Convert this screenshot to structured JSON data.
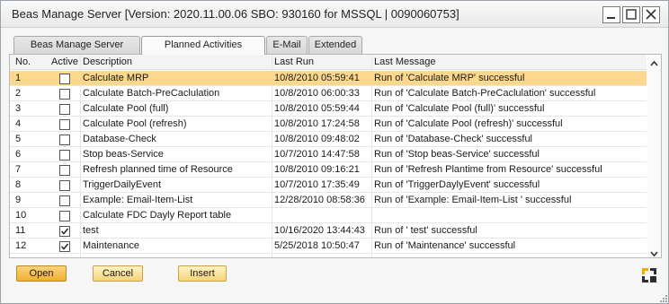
{
  "window": {
    "title": "Beas Manage Server [Version: 2020.11.00.06 SBO: 930160 for MSSQL | 0090060753]"
  },
  "tabs": [
    {
      "label": "Beas Manage Server",
      "active": false
    },
    {
      "label": "Planned Activities",
      "active": true
    },
    {
      "label": "E-Mail",
      "active": false
    },
    {
      "label": "Extended",
      "active": false
    }
  ],
  "grid": {
    "headers": {
      "no": "No.",
      "active": "Active",
      "description": "Description",
      "last_run": "Last Run",
      "last_message": "Last Message"
    },
    "rows": [
      {
        "no": "1",
        "active": false,
        "description": "Calculate MRP",
        "last_run": "10/8/2010 05:59:41",
        "last_message": "Run of 'Calculate MRP' successful",
        "selected": true
      },
      {
        "no": "2",
        "active": false,
        "description": "Calculate Batch-PreCaclulation",
        "last_run": "10/8/2010 06:00:33",
        "last_message": "Run of 'Calculate Batch-PreCaclulation' successful"
      },
      {
        "no": "3",
        "active": false,
        "description": "Calculate Pool (full)",
        "last_run": "10/8/2010 05:59:44",
        "last_message": "Run of 'Calculate Pool (full)' successful"
      },
      {
        "no": "4",
        "active": false,
        "description": "Calculate Pool (refresh)",
        "last_run": "10/8/2010 17:24:58",
        "last_message": "Run of 'Calculate Pool (refresh)' successful"
      },
      {
        "no": "5",
        "active": false,
        "description": "Database-Check",
        "last_run": "10/8/2010 09:48:02",
        "last_message": "Run of 'Database-Check' successful"
      },
      {
        "no": "6",
        "active": false,
        "description": "Stop beas-Service",
        "last_run": "10/7/2010 14:47:58",
        "last_message": "Run of 'Stop beas-Service' successful"
      },
      {
        "no": "7",
        "active": false,
        "description": "Refresh planned time of Resource",
        "last_run": "10/8/2010 09:16:21",
        "last_message": "Run of 'Refresh Plantime from Resource' successful"
      },
      {
        "no": "8",
        "active": false,
        "description": "TriggerDailyEvent",
        "last_run": "10/7/2010 17:35:49",
        "last_message": "Run of 'TriggerDaylyEvent' successful"
      },
      {
        "no": "9",
        "active": false,
        "description": "Example: Email-Item-List",
        "last_run": "12/28/2010 08:58:36",
        "last_message": "Run of 'Example: Email-Item-List ' successful"
      },
      {
        "no": "10",
        "active": false,
        "description": "Calculate FDC Dayly Report table",
        "last_run": "",
        "last_message": ""
      },
      {
        "no": "11",
        "active": true,
        "description": "test",
        "last_run": "10/16/2020 13:44:43",
        "last_message": "Run of ' test' successful"
      },
      {
        "no": "12",
        "active": true,
        "description": "Maintenance",
        "last_run": "5/25/2018 10:50:47",
        "last_message": "Run of 'Maintenance' successful"
      }
    ]
  },
  "buttons": {
    "open": "Open",
    "cancel": "Cancel",
    "insert": "Insert"
  },
  "icons": {
    "minimize": "minimize-icon",
    "maximize": "maximize-icon",
    "close": "close-icon",
    "scroll_up": "chevron-up-icon",
    "scroll_down": "chevron-down-icon",
    "corner": "sap-logo-icon",
    "checkmark": "checkmark-icon"
  },
  "colors": {
    "selected_row": "#fcd78e",
    "button_fill": "#f4d27a",
    "primary_button_fill": "#f0b030",
    "corner_orange": "#f0ab00"
  }
}
